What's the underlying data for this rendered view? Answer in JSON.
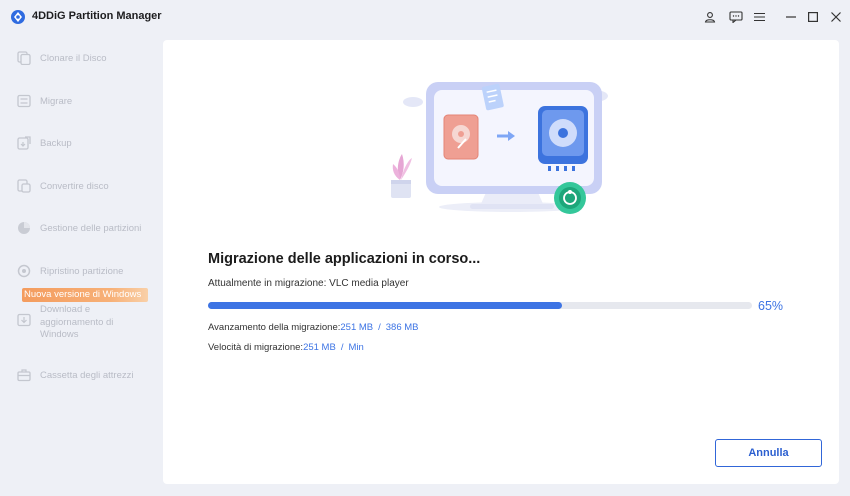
{
  "app": {
    "title": "4DDiG Partition Manager"
  },
  "sidebar": {
    "items": [
      {
        "label": "Clonare il Disco",
        "icon": "clone-disk-icon"
      },
      {
        "label": "Migrare",
        "icon": "migrate-icon"
      },
      {
        "label": "Backup",
        "icon": "backup-icon"
      },
      {
        "label": "Convertire disco",
        "icon": "convert-disk-icon"
      },
      {
        "label": "Gestione delle partizioni",
        "icon": "partition-pie-icon"
      },
      {
        "label": "Ripristino partizione",
        "icon": "restore-partition-icon"
      }
    ],
    "new_badge": "Nuova versione di Windows",
    "download_line1": "Download e",
    "download_line2": "aggiornamento di",
    "download_line3": "Windows",
    "toolbox": "Cassetta degli attrezzi"
  },
  "main": {
    "heading": "Migrazione delle applicazioni in corso...",
    "current_label": "Attualmente in migrazione: VLC media player",
    "progress_percent": 65,
    "percent_text": "65%",
    "progress_label": "Avanzamento della migrazione:",
    "progress_done": "251 MB",
    "progress_separator": "/",
    "progress_total": "386 MB",
    "speed_label": "Velocità di migrazione:",
    "speed_value": "251 MB",
    "speed_separator": "/",
    "speed_unit": "Min",
    "cancel_label": "Annulla"
  },
  "colors": {
    "accent": "#3d74e4",
    "badge": "#f49c5e"
  }
}
